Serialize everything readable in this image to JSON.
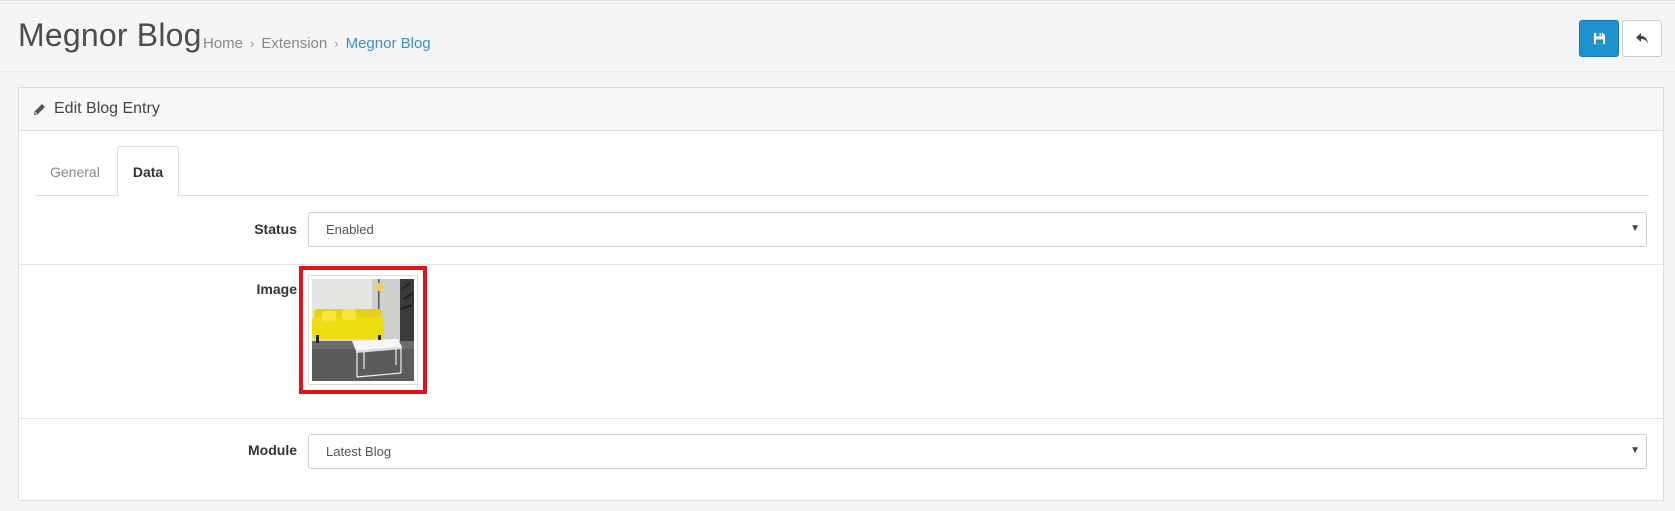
{
  "header": {
    "title": "Megnor Blog",
    "breadcrumb": [
      "Home",
      "Extension",
      "Megnor Blog"
    ],
    "breadcrumb_sep": "›",
    "save_icon": "floppy-disk-icon",
    "back_icon": "reply-arrow-icon"
  },
  "panel": {
    "heading": "Edit Blog Entry",
    "heading_icon": "pencil-icon"
  },
  "tabs": [
    {
      "label": "General",
      "active": false
    },
    {
      "label": "Data",
      "active": true
    }
  ],
  "form": {
    "status": {
      "label": "Status",
      "value": "Enabled"
    },
    "image": {
      "label": "Image",
      "alt": "yellow sofa with white coffee table"
    },
    "module": {
      "label": "Module",
      "value": "Latest Blog"
    }
  },
  "colors": {
    "primary": "#1e91cf",
    "link": "#3a8fd0",
    "highlight": "#e3101d"
  }
}
